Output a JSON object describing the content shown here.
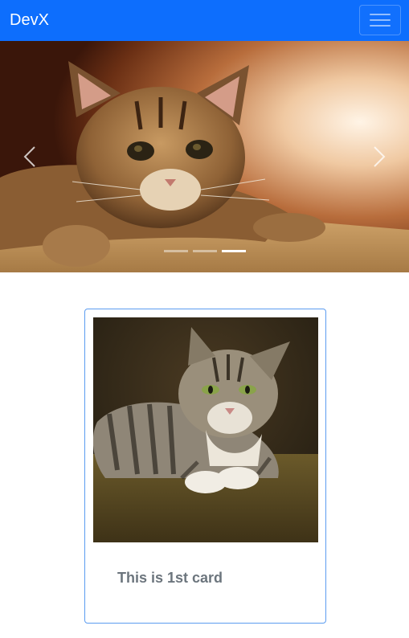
{
  "navbar": {
    "brand": "DevX",
    "bg_color": "#0d6efd",
    "toggler_icon": "hamburger-menu-icon"
  },
  "carousel": {
    "slide_image": "kitten-on-blanket-photo",
    "prev_icon": "chevron-left-icon",
    "next_icon": "chevron-right-icon",
    "slide_count": 3,
    "active_slide": 3
  },
  "cards": [
    {
      "image": "tabby-cat-lying-photo",
      "title": "This is 1st card",
      "border_color": "#5b9cf0"
    }
  ]
}
